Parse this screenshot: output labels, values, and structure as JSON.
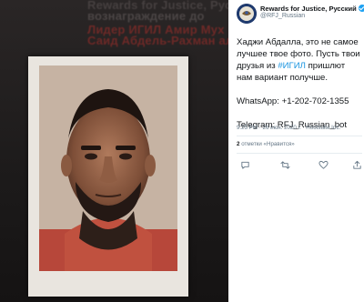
{
  "background_poster": {
    "line1": "Rewards for Justice, Русский",
    "line2": "вознаграждение до",
    "line3": "Лидер ИГИЛ Амир Мух",
    "line4": "Саид Абдель-Рахман ал"
  },
  "tweet": {
    "display_name": "Rewards for Justice, Русский",
    "handle": "@RFJ_Russian",
    "text_line_a": "Хаджи Абдалла, это не самое лучшее твое фото. Пусть твои друзья из ",
    "hashtag": "#ИГИЛ",
    "text_line_b": " пришлют нам вариант получше.",
    "whatsapp": "WhatsApp: +1-202-702-1355",
    "telegram": "Telegram: RFJ_Russian_bot",
    "timestamp": "9:25 PM · 26 июн. 2020 г. · ",
    "source": "Hootsuite Inc.",
    "likes_count": "2",
    "likes_label": "отметки «Нравится»"
  },
  "colors": {
    "link": "#1b95e0",
    "verified": "#1da1f2",
    "muted_text": "#657786",
    "primary_text": "#14171a"
  },
  "icons": {
    "reply": "reply-icon",
    "retweet": "retweet-icon",
    "like": "heart-icon",
    "share": "share-icon",
    "verified": "verified-badge-icon"
  }
}
